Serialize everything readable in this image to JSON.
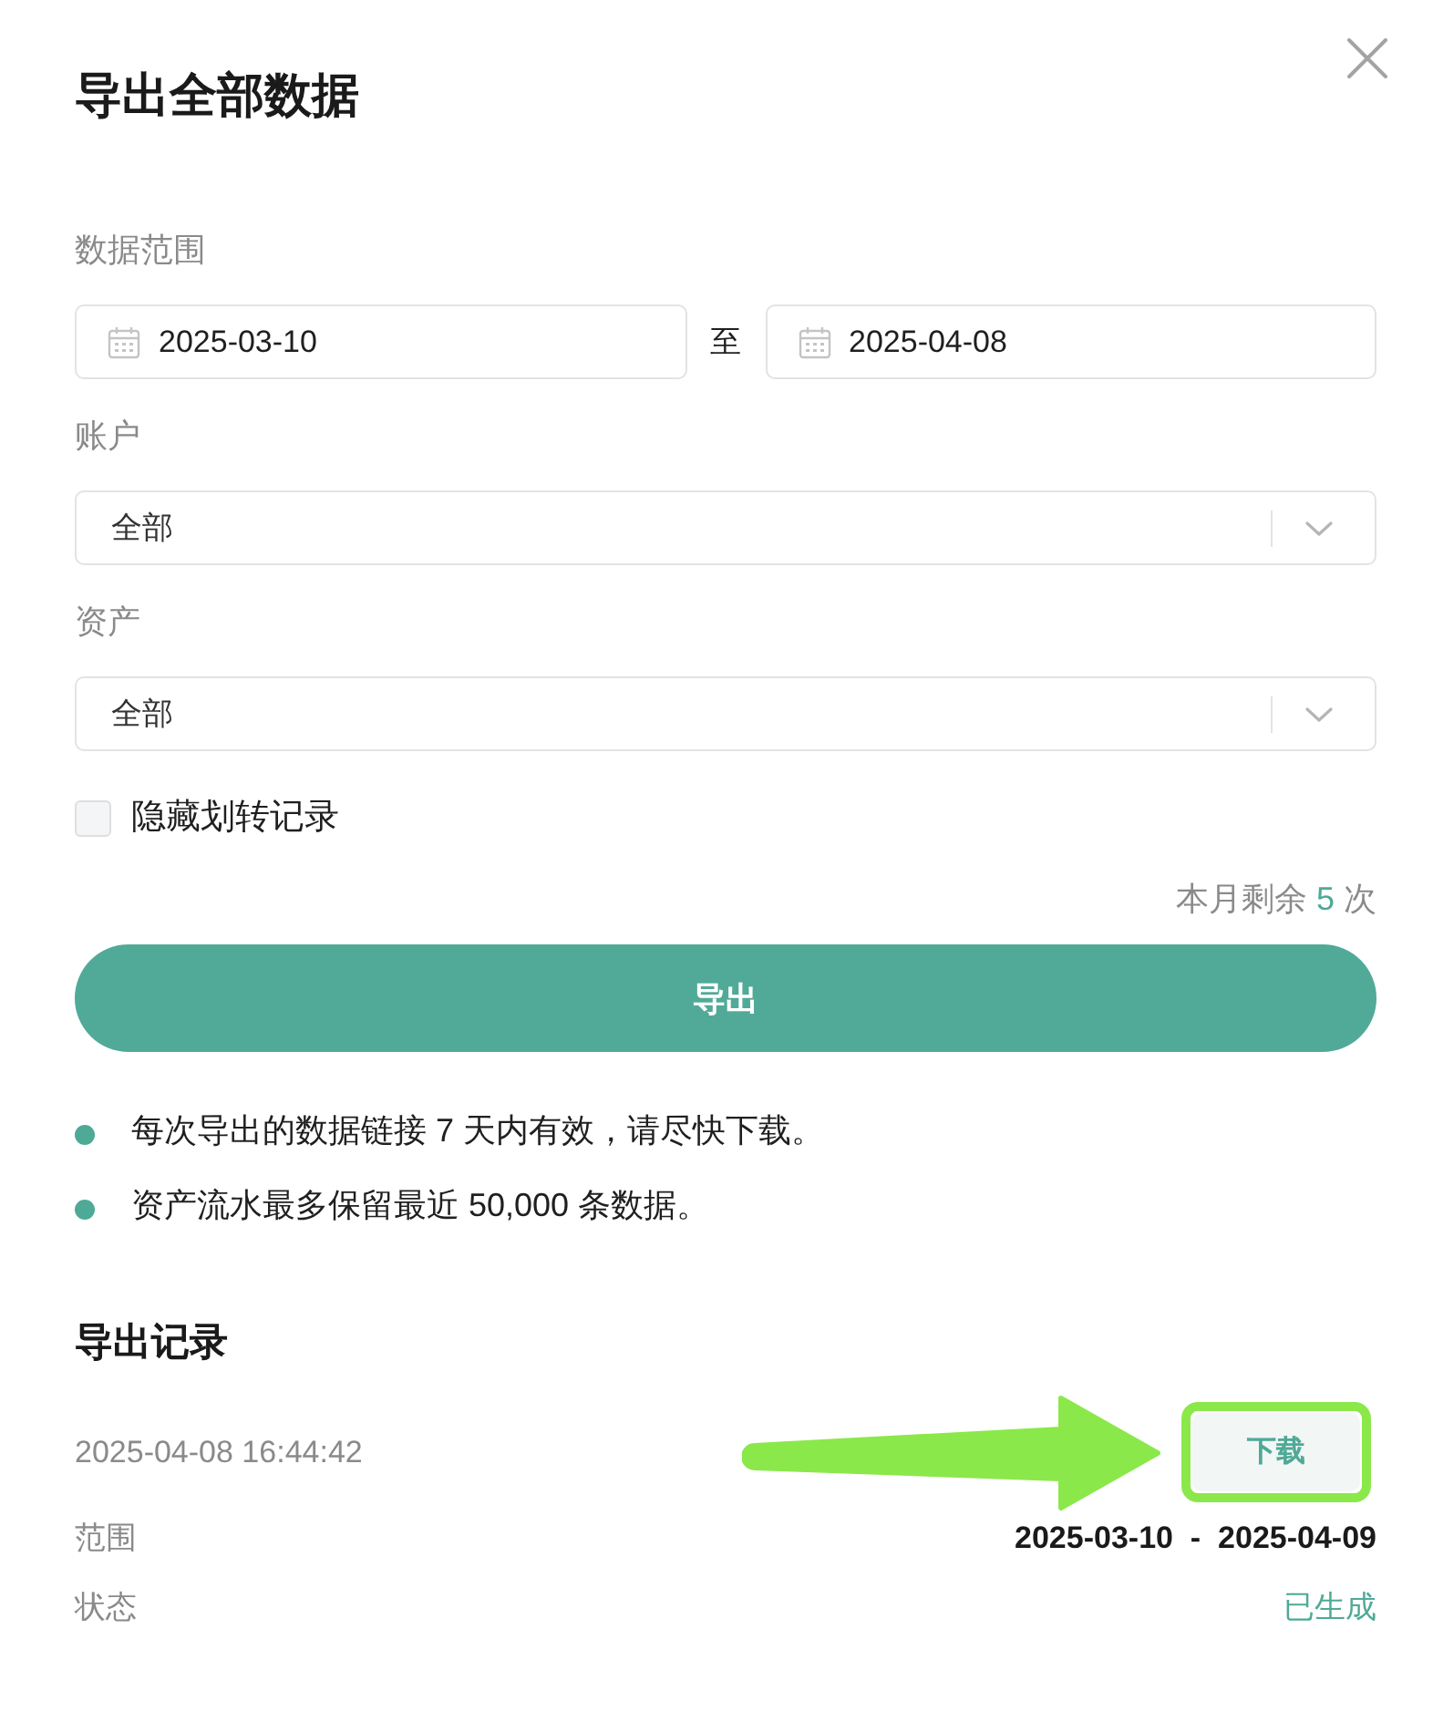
{
  "dialog": {
    "title": "导出全部数据"
  },
  "form": {
    "date_range": {
      "label": "数据范围",
      "start": "2025-03-10",
      "separator": "至",
      "end": "2025-04-08"
    },
    "account": {
      "label": "账户",
      "value": "全部"
    },
    "asset": {
      "label": "资产",
      "value": "全部"
    },
    "hide_transfers": {
      "label": "隐藏划转记录",
      "checked": false
    }
  },
  "quota": {
    "text": "本月剩余 **5** 次"
  },
  "export_button": {
    "label": "导出"
  },
  "notes": [
    "每次导出的数据链接 7 天内有效，请尽快下载。",
    "资产流水最多保留最近 50,000 条数据。"
  ],
  "records": {
    "title": "导出记录",
    "items": [
      {
        "time": "2025-04-08 16:44:42",
        "action": {
          "label": "下载",
          "highlighted": true
        },
        "fields": [
          {
            "kind": "range",
            "label": "范围",
            "value": "2025-03-10  -  2025-04-09"
          },
          {
            "kind": "status",
            "label": "状态",
            "value": "已生成"
          }
        ]
      }
    ]
  }
}
